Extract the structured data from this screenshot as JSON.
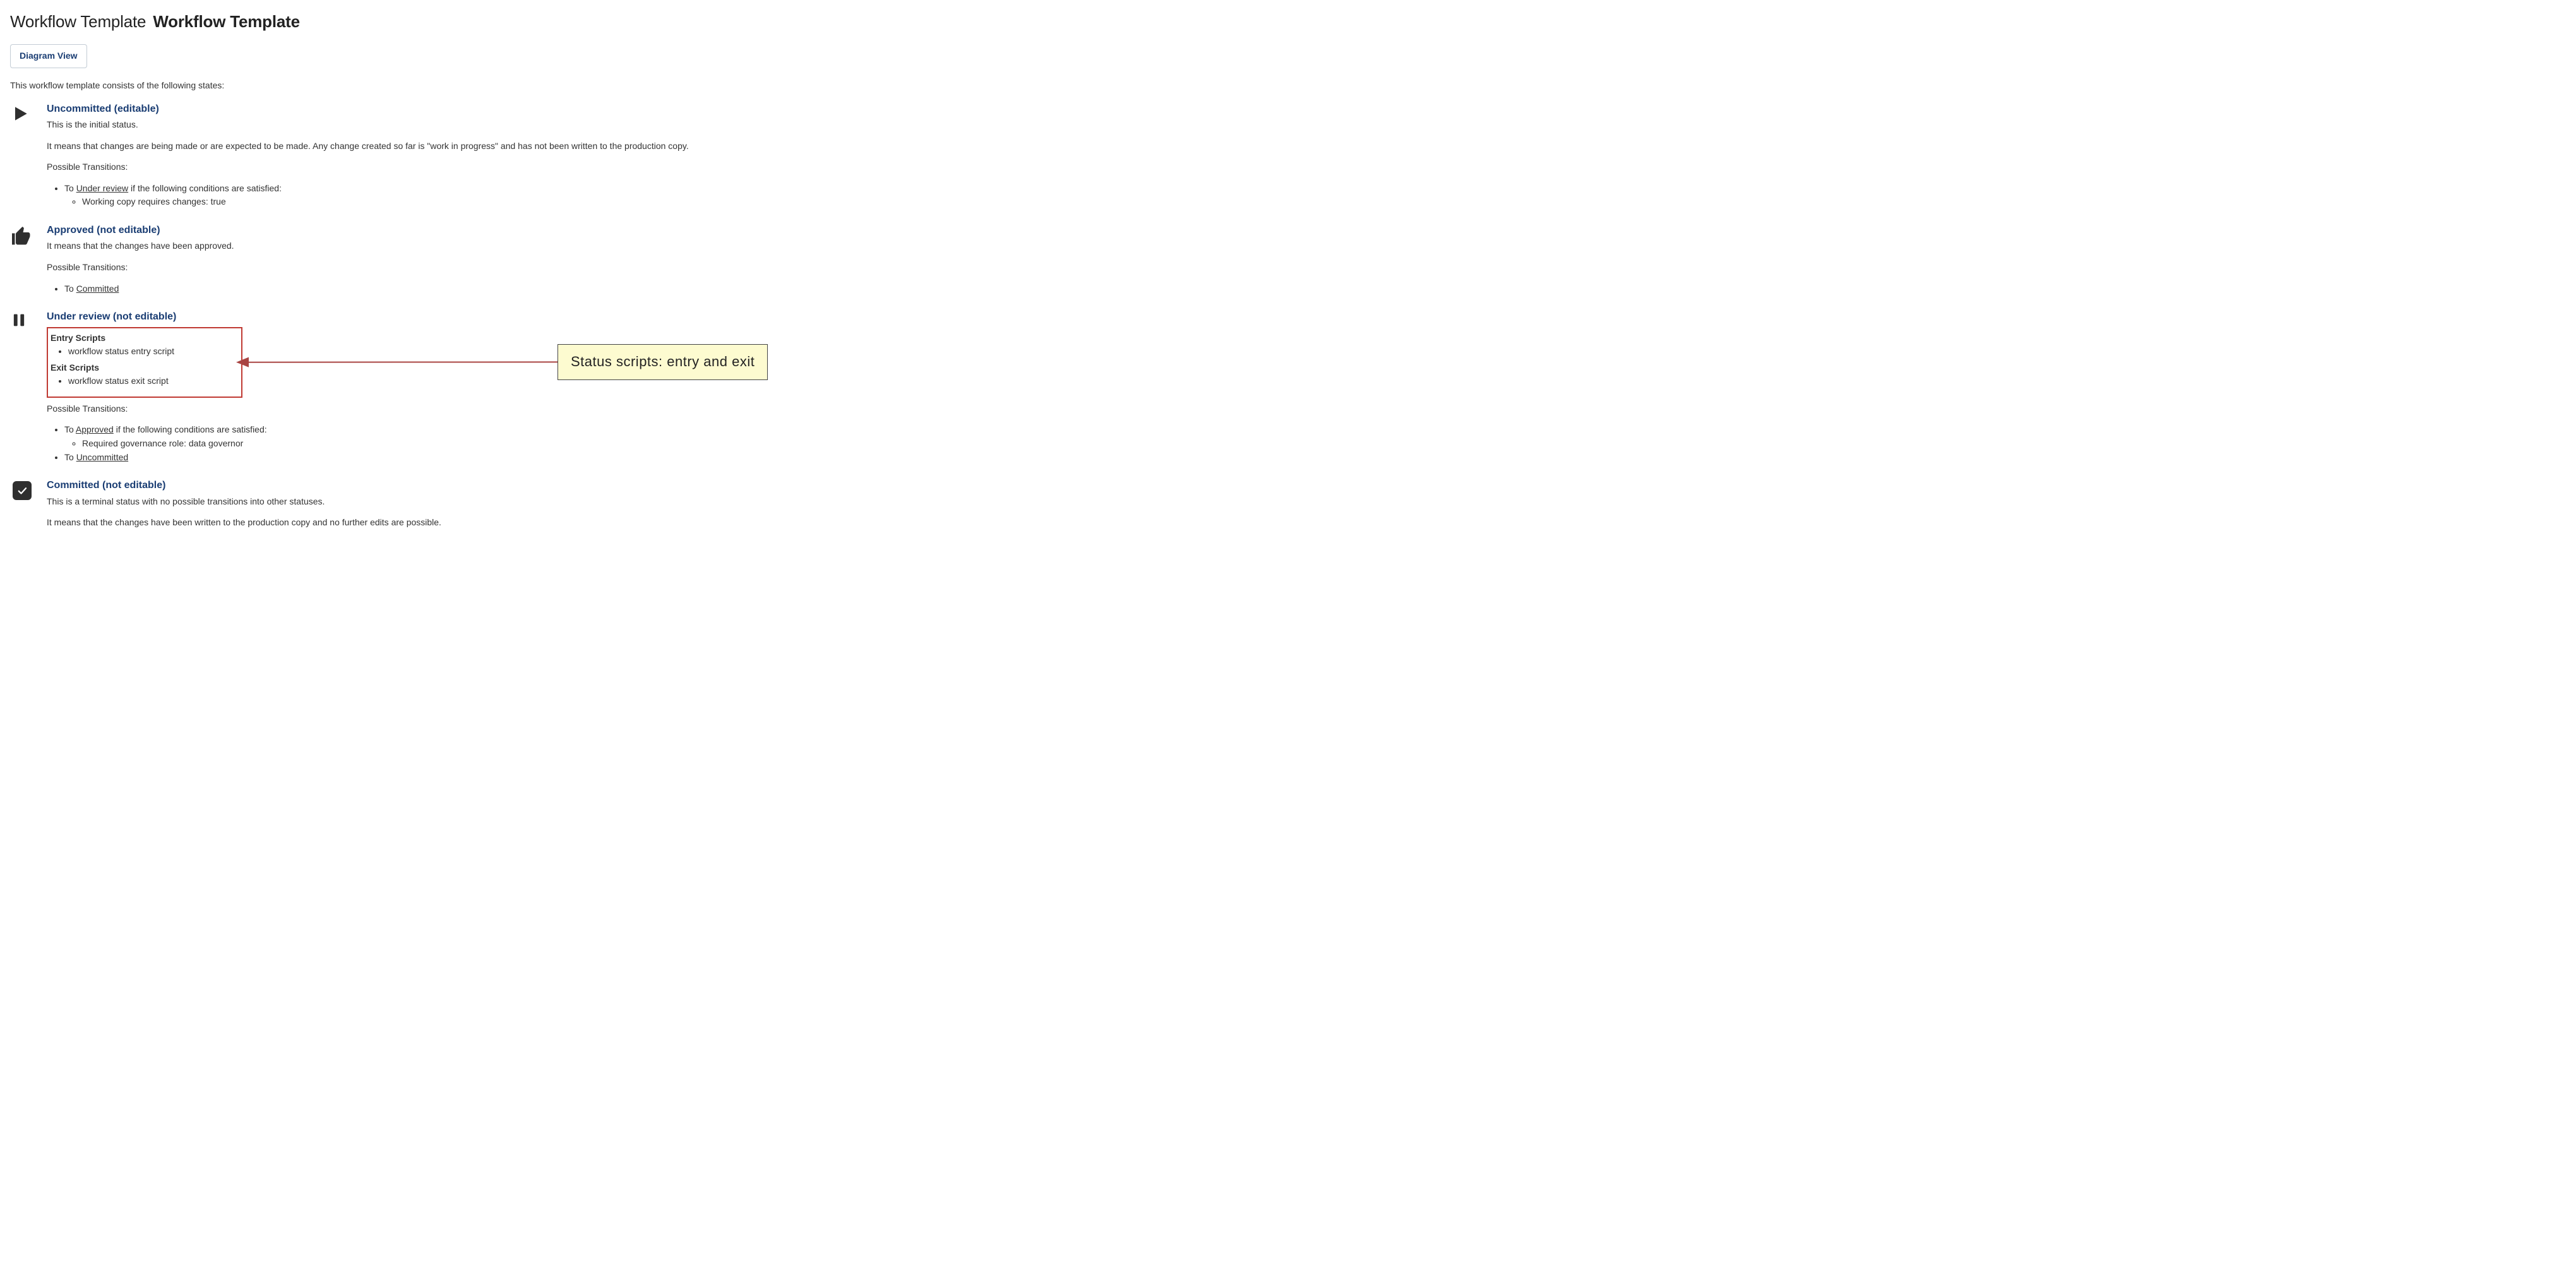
{
  "title": {
    "light": "Workflow Template",
    "bold": "Workflow Template"
  },
  "diagram_button": "Diagram View",
  "intro": "This workflow template consists of the following states:",
  "states": {
    "uncommitted": {
      "heading": "Uncommitted (editable)",
      "line1": "This is the initial status.",
      "line2": "It means that changes are being made or are expected to be made. Any change created so far is \"work in progress\" and has not been written to the production copy.",
      "pt_head": "Possible Transitions:",
      "trans_prefix": "To ",
      "trans_link": "Under review",
      "trans_suffix": " if the following conditions are satisfied:",
      "cond": "Working copy requires changes: true"
    },
    "approved": {
      "heading": "Approved (not editable)",
      "line1": "It means that the changes have been approved.",
      "pt_head": "Possible Transitions:",
      "trans_prefix": "To ",
      "trans_link": "Committed"
    },
    "under_review": {
      "heading": "Under review (not editable)",
      "entry_head": "Entry Scripts",
      "entry_item": "workflow status entry script",
      "exit_head": "Exit Scripts",
      "exit_item": "workflow status exit script",
      "pt_head": "Possible Transitions:",
      "t1_prefix": "To ",
      "t1_link": "Approved",
      "t1_suffix": " if the following conditions are satisfied:",
      "t1_cond": "Required governance role: data governor",
      "t2_prefix": "To ",
      "t2_link": "Uncommitted"
    },
    "committed": {
      "heading": "Committed (not editable)",
      "line1": "This is a terminal status with no possible transitions into other statuses.",
      "line2": "It means that the changes have been written to the production copy and no further edits are possible."
    }
  },
  "callout": {
    "label": "Status scripts: entry and exit"
  }
}
